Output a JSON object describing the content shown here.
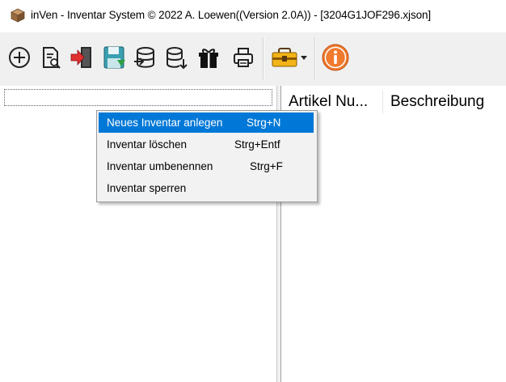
{
  "window": {
    "title": "inVen - Inventar System © 2022 A. Loewen((Version 2.0A)) - [3204G1JOF296.xjson]"
  },
  "toolbar": {
    "buttons": [
      {
        "icon": "add-circle-icon"
      },
      {
        "icon": "search-document-icon"
      },
      {
        "icon": "exit-door-icon"
      },
      {
        "icon": "save-icon"
      },
      {
        "icon": "database-import-icon"
      },
      {
        "icon": "database-export-icon"
      },
      {
        "icon": "gift-box-icon"
      },
      {
        "icon": "printer-icon"
      },
      {
        "icon": "toolbox-icon"
      },
      {
        "icon": "info-icon"
      }
    ]
  },
  "tree": {
    "edit_value": ""
  },
  "table": {
    "columns": [
      "Artikel Nu...",
      "Beschreibung"
    ]
  },
  "context_menu": {
    "items": [
      {
        "label": "Neues Inventar anlegen",
        "shortcut": "Strg+N"
      },
      {
        "label": "Inventar löschen",
        "shortcut": "Strg+Entf"
      },
      {
        "label": "Inventar umbenennen",
        "shortcut": "Strg+F"
      },
      {
        "label": "Inventar sperren",
        "shortcut": ""
      }
    ]
  },
  "colors": {
    "highlight": "#0078d7",
    "info_orange": "#f07a2e",
    "exit_red": "#e03030",
    "save_teal": "#3a9fb0"
  }
}
